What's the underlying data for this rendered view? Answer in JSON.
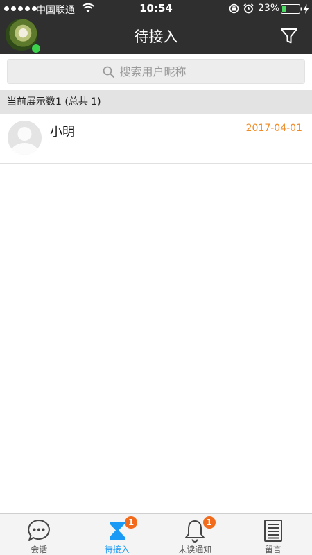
{
  "status_bar": {
    "carrier": "中国联通",
    "time": "10:54",
    "battery_percent": "23%",
    "battery_level": 0.23,
    "icons": [
      "signal-dots-icon",
      "wifi-icon",
      "lock-rotation-icon",
      "alarm-icon",
      "battery-icon",
      "charging-icon"
    ]
  },
  "header": {
    "title": "待接入",
    "online_status_color": "#3bd14b",
    "filter_icon": "filter-icon"
  },
  "search": {
    "placeholder": "搜索用户昵称",
    "value": ""
  },
  "count_bar": {
    "text": "当前展示数1 (总共 1)"
  },
  "list": {
    "items": [
      {
        "name": "小明",
        "date": "2017-04-01",
        "date_color": "#f08a24"
      }
    ]
  },
  "tabs": [
    {
      "label": "会话",
      "icon": "chat-bubble-icon",
      "badge": ""
    },
    {
      "label": "待接入",
      "icon": "hourglass-icon",
      "badge": "1",
      "active": true,
      "active_color": "#1b9af5"
    },
    {
      "label": "未读通知",
      "icon": "bell-icon",
      "badge": "1"
    },
    {
      "label": "留言",
      "icon": "document-icon",
      "badge": ""
    }
  ],
  "colors": {
    "header_bg": "#2f2f2f",
    "badge": "#f26b1d",
    "accent": "#1b9af5"
  }
}
